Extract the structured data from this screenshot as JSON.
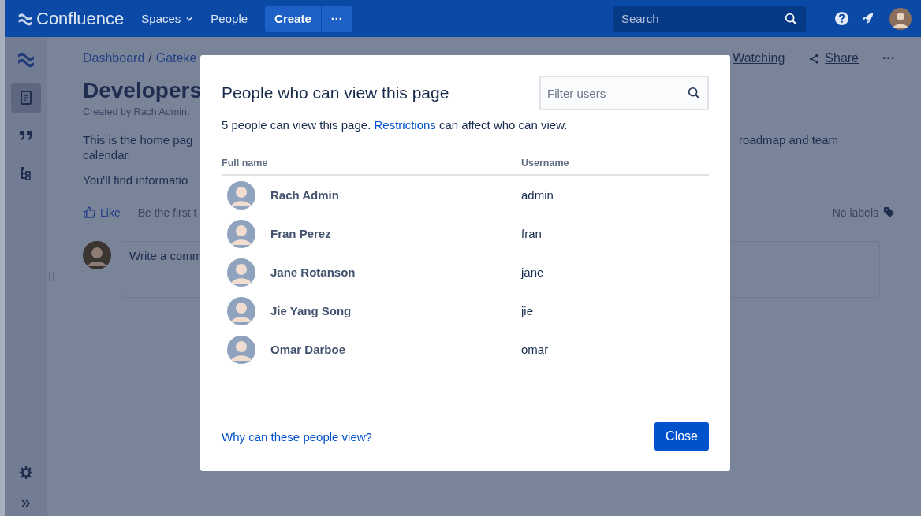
{
  "top_nav": {
    "logo": "Confluence",
    "items": [
      {
        "label": "Spaces",
        "dropdown": true
      },
      {
        "label": "People",
        "dropdown": false
      }
    ],
    "create_button": "Create",
    "more_button": "···",
    "search": {
      "placeholder": "Search"
    }
  },
  "sidebar": {
    "items": [
      {
        "kind": "pages",
        "selected": true
      },
      {
        "kind": "blog",
        "selected": false
      },
      {
        "kind": "tree",
        "selected": false
      }
    ],
    "bottom": [
      {
        "kind": "settings"
      },
      {
        "kind": "expand"
      }
    ]
  },
  "page": {
    "breadcrumbs": [
      "Dashboard",
      "Gateke"
    ],
    "breadcrumb_separator": "/",
    "actions": [
      {
        "label": "Watching",
        "kind": "watch"
      },
      {
        "label": "Share",
        "kind": "share"
      }
    ],
    "more": "···",
    "title": "Developers",
    "byline": "Created by Rach Admin,",
    "body_left": "This is the home pag",
    "body_right": "roadmap and team",
    "body_line2": "calendar.",
    "body_line3": "You'll find informatio",
    "like": "Like",
    "like_note": "Be the first t",
    "labels": "No labels",
    "comment_placeholder": "Write a comm"
  },
  "dialog": {
    "title": "People who can view this page",
    "filter": {
      "placeholder": "Filter users"
    },
    "summary_before": "5 people can view this page. ",
    "summary_link": "Restrictions",
    "summary_after": " can affect who can view.",
    "columns": [
      "Full name",
      "Username"
    ],
    "rows": [
      {
        "name": "Rach Admin",
        "username": "admin"
      },
      {
        "name": "Fran Perez",
        "username": "fran"
      },
      {
        "name": "Jane Rotanson",
        "username": "jane"
      },
      {
        "name": "Jie Yang Song",
        "username": "jie"
      },
      {
        "name": "Omar Darboe",
        "username": "omar"
      }
    ],
    "footer_link": "Why can these people view?",
    "close_button": "Close"
  }
}
